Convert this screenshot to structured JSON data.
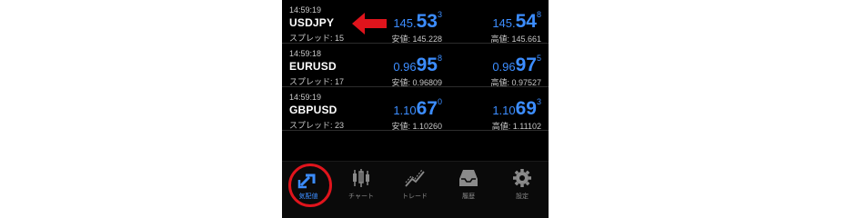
{
  "quotes": [
    {
      "time": "14:59:19",
      "symbol": "USDJPY",
      "spread": "スプレッド: 15",
      "bid": {
        "pre": "145.",
        "big": "53",
        "sup": "3"
      },
      "ask": {
        "pre": "145.",
        "big": "54",
        "sup": "8"
      },
      "low": "安値: 145.228",
      "high": "高値: 145.661"
    },
    {
      "time": "14:59:18",
      "symbol": "EURUSD",
      "spread": "スプレッド: 17",
      "bid": {
        "pre": "0.96",
        "big": "95",
        "sup": "8"
      },
      "ask": {
        "pre": "0.96",
        "big": "97",
        "sup": "5"
      },
      "low": "安値: 0.96809",
      "high": "高値: 0.97527"
    },
    {
      "time": "14:59:19",
      "symbol": "GBPUSD",
      "spread": "スプレッド: 23",
      "bid": {
        "pre": "1.10",
        "big": "67",
        "sup": "0"
      },
      "ask": {
        "pre": "1.10",
        "big": "69",
        "sup": "3"
      },
      "low": "安値: 1.10260",
      "high": "高値: 1.11102"
    }
  ],
  "tabs": [
    {
      "label": "気配値",
      "icon": "quotes-arrows-icon",
      "active": true
    },
    {
      "label": "チャート",
      "icon": "candlestick-chart-icon",
      "active": false
    },
    {
      "label": "トレード",
      "icon": "trade-line-icon",
      "active": false
    },
    {
      "label": "履歴",
      "icon": "inbox-tray-icon",
      "active": false
    },
    {
      "label": "設定",
      "icon": "gear-icon",
      "active": false
    }
  ],
  "colors": {
    "price_blue": "#3c8dff",
    "annotation_red": "#e0141c",
    "background": "#000000"
  },
  "annotations": {
    "arrow": "left-pointing-arrow-icon",
    "circle": "highlight-circle"
  }
}
